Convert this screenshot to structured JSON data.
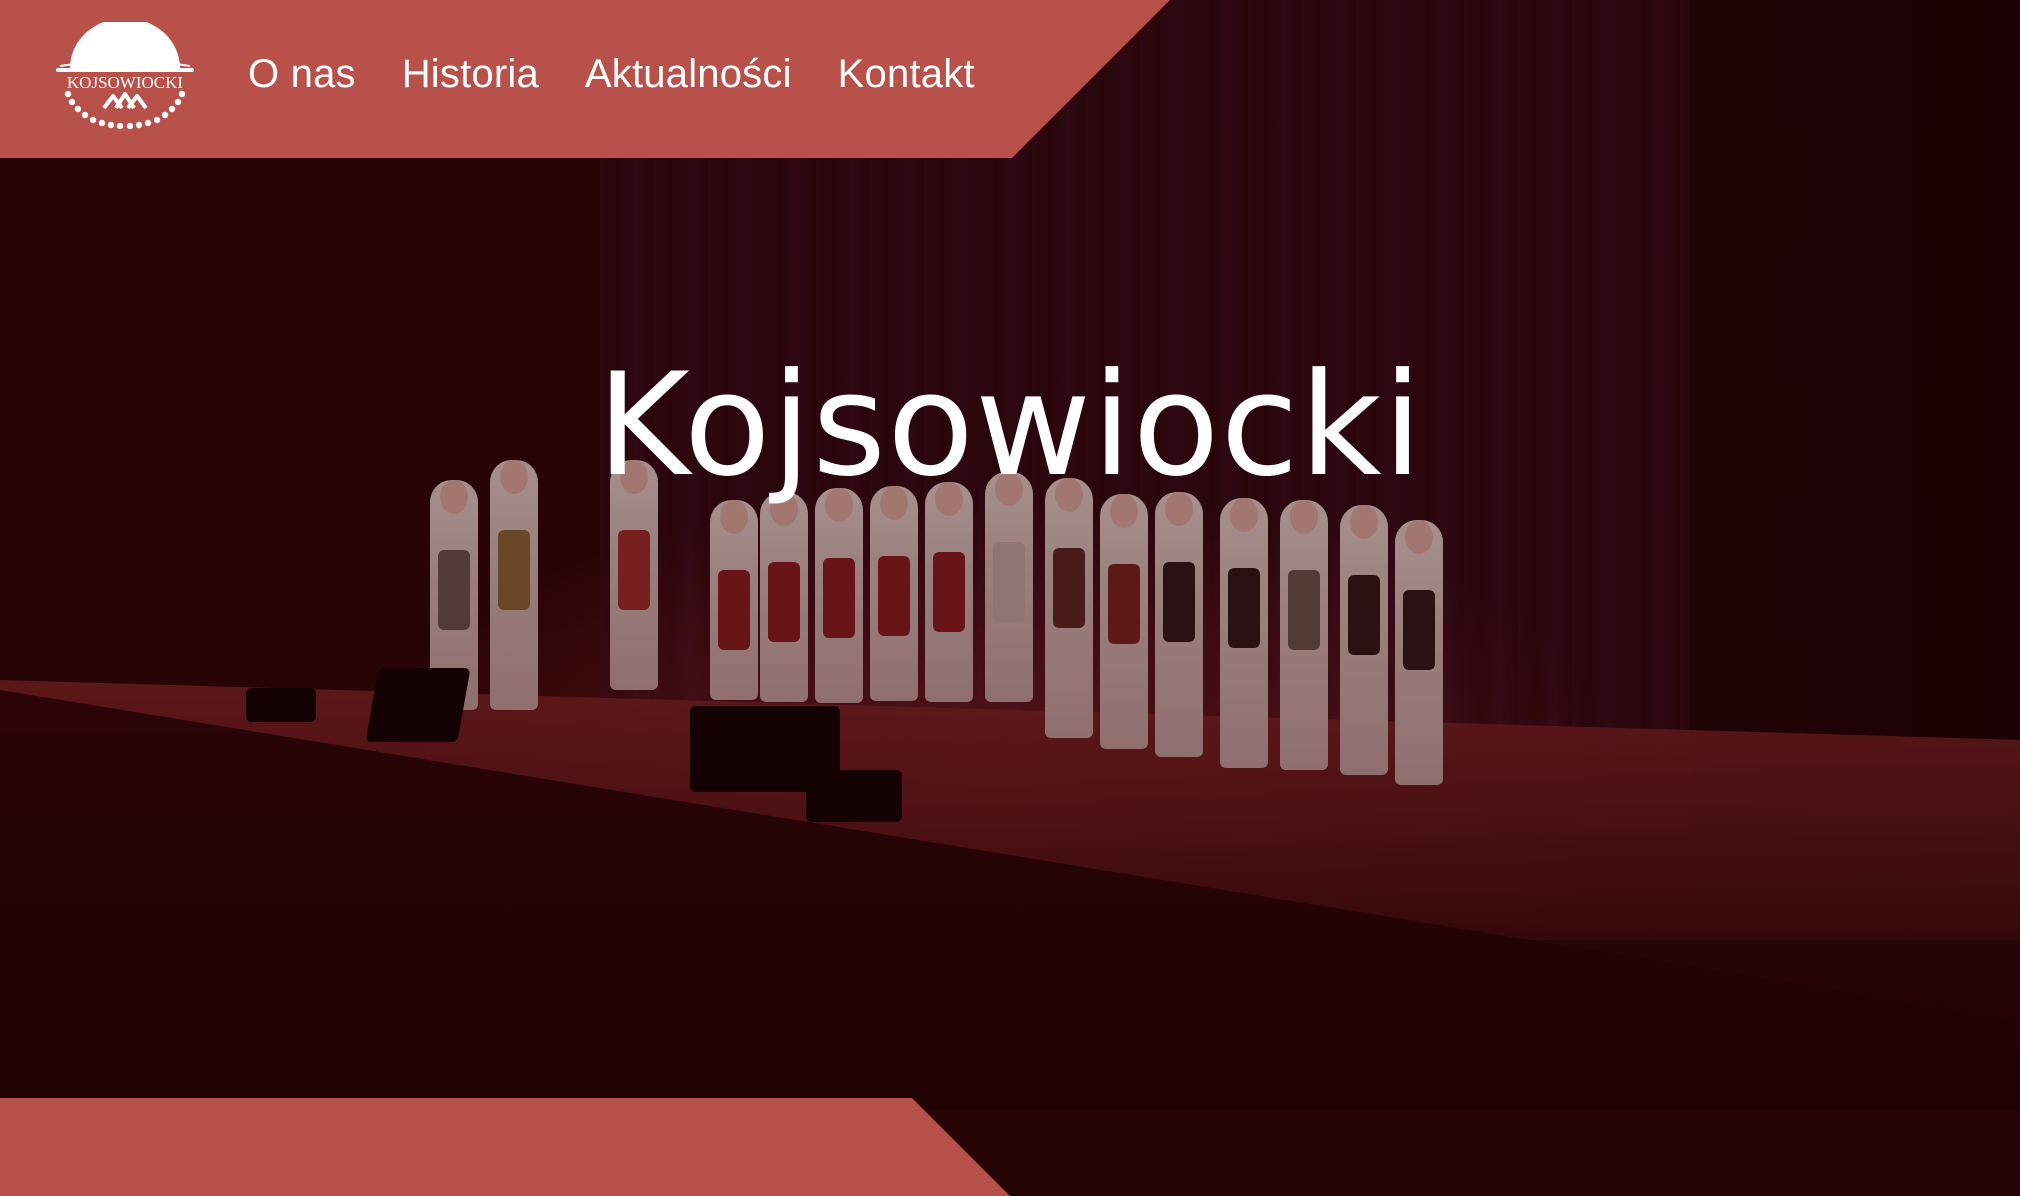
{
  "header": {
    "logo_alt": "KOJSOWIOCKI",
    "logo_text": "KOJSOWIOCKI",
    "nav": [
      {
        "label": "O nas"
      },
      {
        "label": "Historia"
      },
      {
        "label": "Aktualności"
      },
      {
        "label": "Kontakt"
      }
    ]
  },
  "hero": {
    "title": "Kojsowiocki",
    "image": "stage-performance-photo"
  },
  "colors": {
    "accent": "#b8514a",
    "hero_tint": "#2a0608",
    "text": "#ffffff"
  }
}
